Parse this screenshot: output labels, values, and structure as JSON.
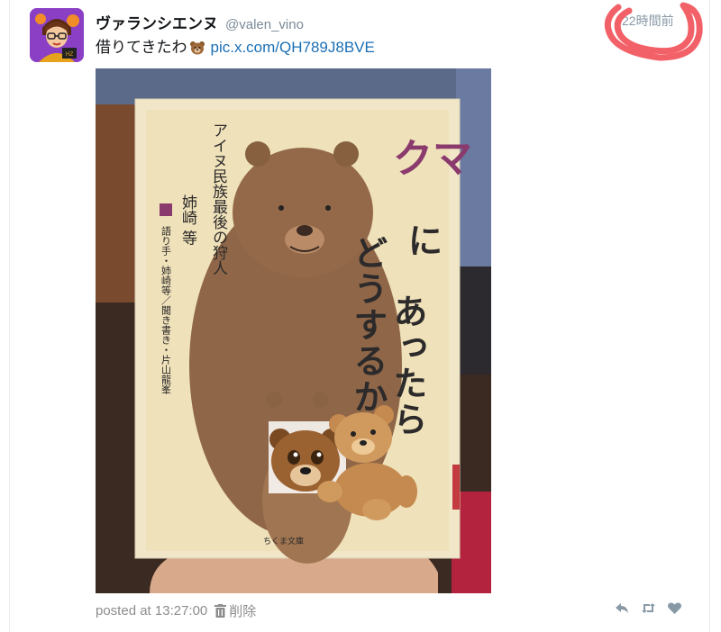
{
  "user": {
    "display_name": "ヴァランシエンヌ",
    "handle": "@valen_vino"
  },
  "tweet": {
    "time_ago": "22時間前",
    "text": "借りてきたわ",
    "emoji": "bear-face-emoji",
    "link": "pic.x.com/QH789J8BVE"
  },
  "photo": {
    "book": {
      "title_line1": "クマ",
      "title_line1b": "に",
      "title_line2": "あったら",
      "title_line3": "どうするか",
      "subtitle": "アイヌ民族最後の狩人",
      "author": "姉崎 等",
      "credits": "語り手・姉崎等／聞き書き・片山龍峯",
      "publisher": "ちくま文庫"
    }
  },
  "footer": {
    "posted_label": "posted at 13:27:00",
    "delete_label": "削除"
  },
  "colors": {
    "link": "#1b6fb5",
    "annotation_red": "#f2545b",
    "muted": "#8c8c8c",
    "title_purple": "#8b3a6e"
  },
  "icons": [
    "reply-icon",
    "retweet-icon",
    "like-icon",
    "trash-icon"
  ]
}
